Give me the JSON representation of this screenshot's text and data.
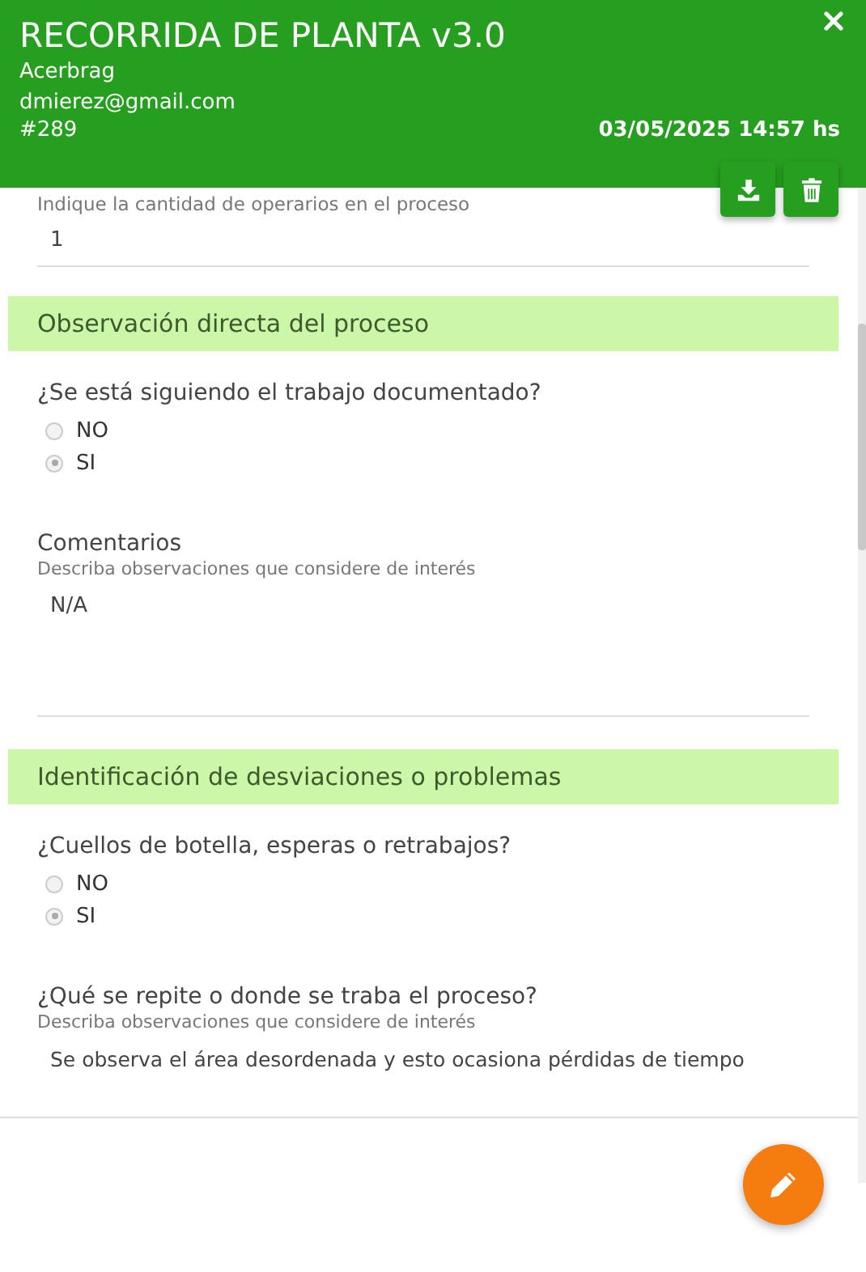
{
  "header": {
    "title": "RECORRIDA DE PLANTA v3.0",
    "company": "Acerbrag",
    "email": "dmierez@gmail.com",
    "number": "#289",
    "datetime": "03/05/2025 14:57 hs"
  },
  "fields": [
    {
      "kind": "text",
      "hint": "Indique la cantidad de operarios en el proceso",
      "value": "1"
    }
  ],
  "sections": [
    {
      "title": "Observación directa del proceso",
      "fields": [
        {
          "kind": "radio",
          "label": "¿Se está siguiendo el trabajo documentado?",
          "options": [
            {
              "label": "NO",
              "selected": false
            },
            {
              "label": "SI",
              "selected": true
            }
          ]
        },
        {
          "kind": "textarea",
          "label": "Comentarios",
          "hint": "Describa observaciones que considere de interés",
          "value": "N/A"
        }
      ]
    },
    {
      "title": "Identificación de desviaciones o problemas",
      "fields": [
        {
          "kind": "radio",
          "label": "¿Cuellos de botella, esperas o retrabajos?",
          "options": [
            {
              "label": "NO",
              "selected": false
            },
            {
              "label": "SI",
              "selected": true
            }
          ]
        },
        {
          "kind": "text",
          "label": "¿Qué se repite o donde se traba el proceso?",
          "hint": "Describa observaciones que considere de interés",
          "value": "Se observa el área desordenada y esto ocasiona pérdidas de tiempo"
        }
      ]
    }
  ]
}
